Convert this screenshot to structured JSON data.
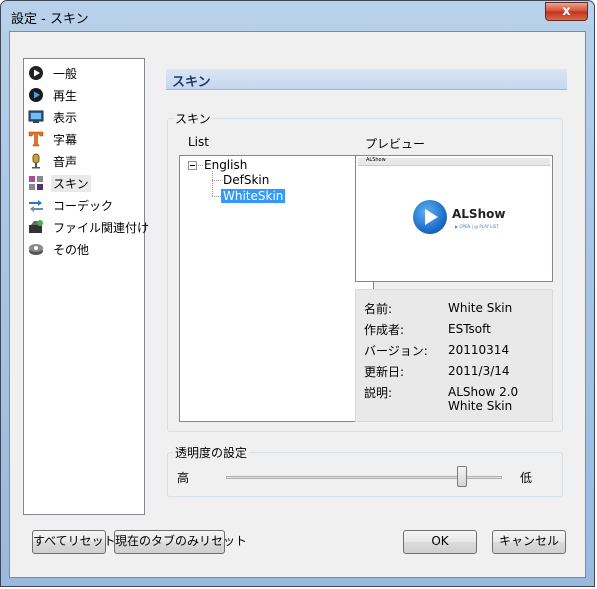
{
  "window": {
    "title": "設定 - スキン",
    "close_glyph": "x"
  },
  "nav": {
    "items": [
      {
        "label": "一般",
        "icon": "play-disc-icon"
      },
      {
        "label": "再生",
        "icon": "play-icon"
      },
      {
        "label": "表示",
        "icon": "monitor-icon"
      },
      {
        "label": "字幕",
        "icon": "text-t-icon"
      },
      {
        "label": "音声",
        "icon": "microphone-icon"
      },
      {
        "label": "スキン",
        "icon": "skin-palette-icon",
        "selected": true
      },
      {
        "label": "コーデック",
        "icon": "codec-icon"
      },
      {
        "label": "ファイル関連付け",
        "icon": "file-association-icon"
      },
      {
        "label": "その他",
        "icon": "misc-gear-icon"
      }
    ]
  },
  "section": {
    "header": "スキン"
  },
  "skin_group": {
    "legend": "スキン",
    "list_label": "List",
    "preview_label": "プレビュー",
    "tree": {
      "root": "English",
      "children": [
        "DefSkin",
        "WhiteSkin"
      ],
      "selected": "WhiteSkin"
    },
    "preview": {
      "window_title": "ALShow",
      "brand": "ALShow",
      "links": "▶ OPEN  | ▤ PLAY LIST"
    },
    "info": [
      {
        "key": "名前:",
        "value": "White Skin"
      },
      {
        "key": "作成者:",
        "value": "ESTsoft"
      },
      {
        "key": "バージョン:",
        "value": "20110314"
      },
      {
        "key": "更新日:",
        "value": "2011/3/14"
      },
      {
        "key": "説明:",
        "value": "ALShow 2.0 White Skin"
      }
    ]
  },
  "transparency": {
    "legend": "透明度の設定",
    "high_label": "高",
    "low_label": "低",
    "value_fraction": 0.87
  },
  "buttons": {
    "reset_all": "すべてリセット",
    "reset_tab": "現在のタブのみリセット",
    "ok": "OK",
    "cancel": "キャンセル"
  },
  "colors": {
    "selection": "#3399ff",
    "header_text": "#1b3a74",
    "close_red": "#c03218",
    "play_blue": "#1f6fc9"
  }
}
